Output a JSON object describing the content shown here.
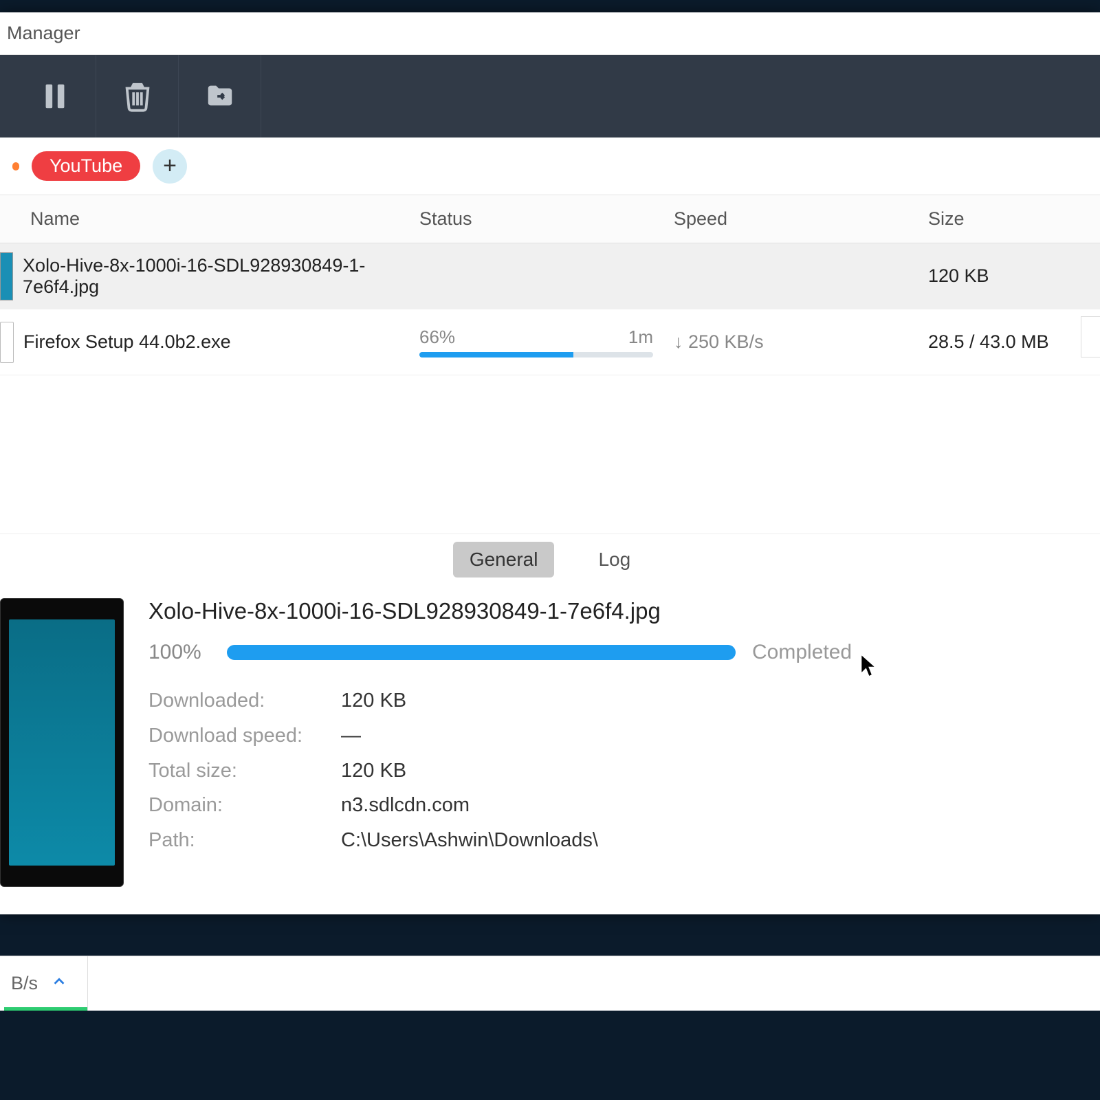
{
  "window": {
    "title": "Manager"
  },
  "tags": {
    "youtube": "YouTube",
    "add": "+"
  },
  "columns": {
    "name": "Name",
    "status": "Status",
    "speed": "Speed",
    "size": "Size"
  },
  "rows": [
    {
      "name": "Xolo-Hive-8x-1000i-16-SDL928930849-1-7e6f4.jpg",
      "status_pct": "",
      "status_eta": "",
      "speed": "",
      "size": "120 KB",
      "progress_pct": 100,
      "selected": true,
      "icon": "thumb"
    },
    {
      "name": "Firefox Setup 44.0b2.exe",
      "status_pct": "66%",
      "status_eta": "1m",
      "speed": "↓ 250 KB/s",
      "size": "28.5 / 43.0 MB",
      "progress_pct": 66,
      "selected": false,
      "icon": "file"
    }
  ],
  "detail": {
    "tabs": {
      "general": "General",
      "log": "Log"
    },
    "filename": "Xolo-Hive-8x-1000i-16-SDL928930849-1-7e6f4.jpg",
    "pct": "100%",
    "status": "Completed",
    "downloaded_label": "Downloaded:",
    "downloaded_value": "120 KB",
    "speed_label": "Download speed:",
    "speed_value": "—",
    "total_label": "Total size:",
    "total_value": "120 KB",
    "domain_label": "Domain:",
    "domain_value": "n3.sdlcdn.com",
    "path_label": "Path:",
    "path_value": "C:\\Users\\Ashwin\\Downloads\\"
  },
  "statusbar": {
    "speed": "B/s"
  }
}
